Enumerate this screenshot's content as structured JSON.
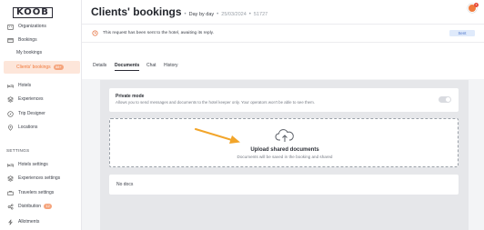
{
  "app": {
    "logo": "KOOB"
  },
  "sidebar": {
    "items": [
      {
        "label": "Organizations",
        "icon": "building-icon"
      },
      {
        "label": "Bookings",
        "icon": "bookings-icon"
      },
      {
        "label": "My bookings"
      },
      {
        "label": "Clients' bookings",
        "badge": "88+",
        "active": true
      },
      {
        "label": "Hotels",
        "icon": "bed-icon"
      },
      {
        "label": "Experiences",
        "icon": "layers-icon"
      },
      {
        "label": "Trip Designer",
        "icon": "compass-icon"
      },
      {
        "label": "Locations",
        "icon": "location-pin-icon"
      }
    ],
    "settings_title": "SETTINGS",
    "settings_items": [
      {
        "label": "Hotels settings",
        "icon": "bed-icon"
      },
      {
        "label": "Experiences settings",
        "icon": "layers-icon"
      },
      {
        "label": "Travelers settings",
        "icon": "travelers-icon"
      },
      {
        "label": "Distribution",
        "icon": "distribution-icon",
        "badge": "12"
      },
      {
        "label": "Allotments",
        "icon": "lightning-icon"
      }
    ]
  },
  "header": {
    "title": "Clients' bookings",
    "separator": "•",
    "crumb1": "Day by day",
    "crumb2": "25/03/2024",
    "crumb3": "51727",
    "avatar_badge": "1"
  },
  "notice": {
    "text": "This request has been sent to the hotel, awaiting its reply.",
    "button": "Sent"
  },
  "tabs": [
    {
      "label": "Details"
    },
    {
      "label": "Documents",
      "active": true
    },
    {
      "label": "Chat"
    },
    {
      "label": "History"
    }
  ],
  "private_mode": {
    "title": "Private mode",
    "description": "Allows you to send messages and documents to the hotel keeper only. Your operators won't be able to see them.",
    "enabled": false
  },
  "upload": {
    "title": "Upload shared documents",
    "subtitle": "Documents will be saved in the booking and shared"
  },
  "documents": {
    "empty_text": "No docs"
  },
  "colors": {
    "accent": "#f07a3c",
    "active_bg": "#fde6da",
    "sent_bg": "#dfeafb"
  }
}
